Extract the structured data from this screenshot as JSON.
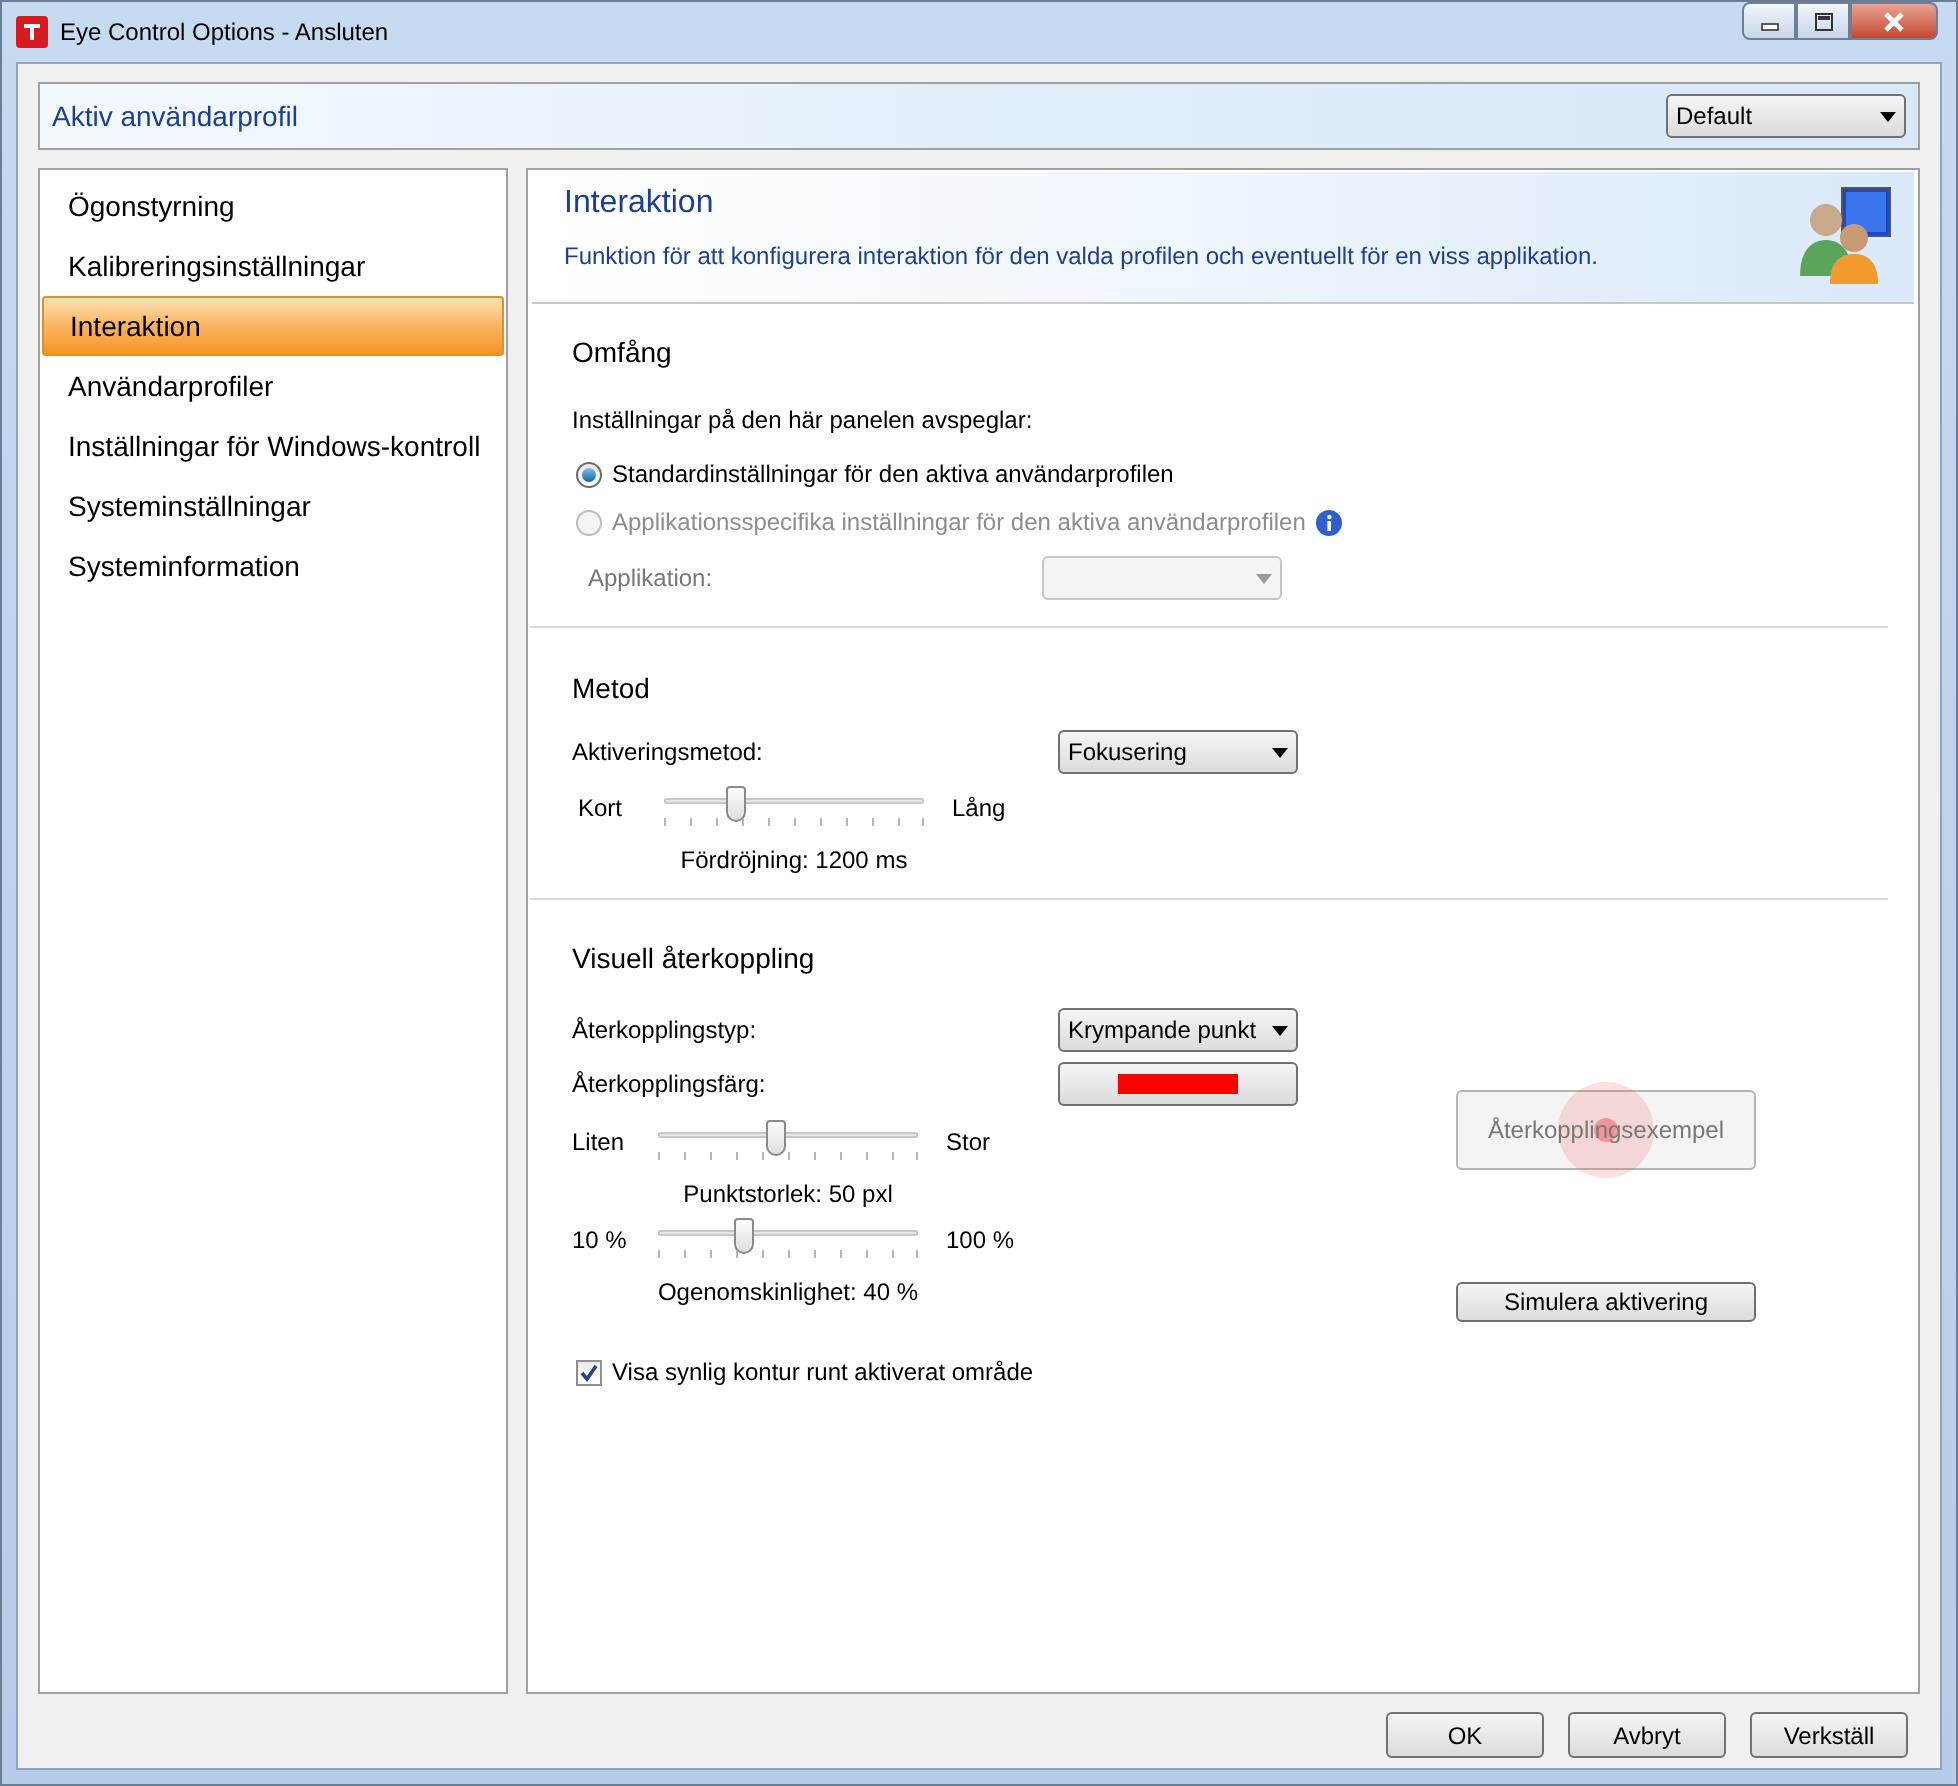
{
  "window": {
    "title": "Eye Control Options - Ansluten"
  },
  "profile_bar": {
    "label": "Aktiv användarprofil",
    "dropdown": {
      "value": "Default"
    }
  },
  "sidebar": {
    "items": [
      {
        "label": "Ögonstyrning",
        "selected": false
      },
      {
        "label": "Kalibreringsinställningar",
        "selected": false
      },
      {
        "label": "Interaktion",
        "selected": true
      },
      {
        "label": "Användarprofiler",
        "selected": false
      },
      {
        "label": "Inställningar för Windows-kontroll",
        "selected": false
      },
      {
        "label": "Systeminställningar",
        "selected": false
      },
      {
        "label": "Systeminformation",
        "selected": false
      }
    ]
  },
  "header": {
    "title": "Interaktion",
    "description": "Funktion för att konfigurera interaktion för den valda profilen och eventuellt för en viss applikation."
  },
  "scope": {
    "title": "Omfång",
    "prompt": "Inställningar på den här panelen avspeglar:",
    "radios": [
      {
        "label": "Standardinställningar för den aktiva användarprofilen",
        "selected": true,
        "disabled": false,
        "info": false
      },
      {
        "label": "Applikationsspecifika inställningar för den aktiva användarprofilen",
        "selected": false,
        "disabled": true,
        "info": true
      }
    ],
    "application": {
      "label": "Applikation:",
      "disabled": true
    }
  },
  "method": {
    "title": "Metod",
    "activation": {
      "label": "Aktiveringsmetod:",
      "value": "Fokusering"
    },
    "slider": {
      "min_label": "Kort",
      "max_label": "Lång",
      "level": 0.28,
      "reading": "Fördröjning: 1200 ms"
    }
  },
  "feedback": {
    "title": "Visuell återkoppling",
    "type": {
      "label": "Återkopplingstyp:",
      "value": "Krympande punkt"
    },
    "color": {
      "label": "Återkopplingsfärg:",
      "color": "#ff0000"
    },
    "sliders": [
      {
        "min_label": "Liten",
        "max_label": "Stor",
        "level": 0.45,
        "reading": "Punktstorlek: 50 pxl"
      },
      {
        "min_label": "10 %",
        "max_label": "100 %",
        "level": 0.33,
        "reading": "Ogenomskinlighet: 40 %"
      }
    ],
    "checkbox": {
      "label": "Visa synlig kontur runt aktiverat område",
      "checked": true
    },
    "example_button": {
      "label": "Återkopplingsexempel",
      "disabled": true
    },
    "simulate_button": {
      "label": "Simulera aktivering",
      "disabled": false
    }
  },
  "footer": {
    "buttons": [
      {
        "label": "OK"
      },
      {
        "label": "Avbryt"
      },
      {
        "label": "Verkställ"
      }
    ]
  }
}
